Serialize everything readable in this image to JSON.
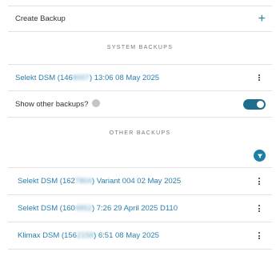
{
  "create": {
    "label": "Create Backup",
    "icon": "plus-icon"
  },
  "system": {
    "title": "SYSTEM BACKUPS",
    "items": [
      {
        "prefix": "Selekt DSM (146",
        "blurred": "8007",
        "suffix": ") 13:06 08 May 2025"
      }
    ]
  },
  "toggle": {
    "label": "Show other backups?",
    "checked": true
  },
  "other": {
    "title": "OTHER BACKUPS",
    "items": [
      {
        "prefix": "Selekt DSM (162",
        "blurred": "7804",
        "suffix": ") Variant 004 02 May 2025"
      },
      {
        "prefix": "Selekt DSM (160",
        "blurred": "4852",
        "suffix": ") 7:26 29 April 2025 D110"
      },
      {
        "prefix": "Klimax DSM (156",
        "blurred": "2158",
        "suffix": ") 6:51 08 May 2025"
      }
    ]
  },
  "colors": {
    "accent": "#2a7fae",
    "toggle_on": "#1f6d8c",
    "divider": "#e3e3e3"
  }
}
